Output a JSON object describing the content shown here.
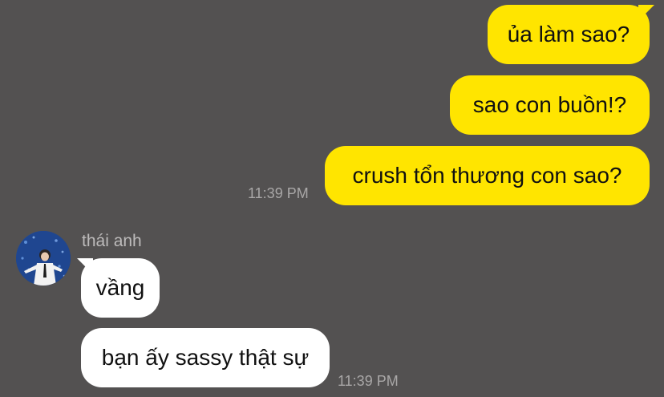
{
  "conversation": {
    "outgoing": [
      {
        "text": "ủa làm sao?"
      },
      {
        "text": "sao con buồn!?"
      },
      {
        "text": "crush tổn thương con sao?"
      }
    ],
    "outgoing_time": "11:39 PM",
    "incoming": {
      "sender_name": "thái anh",
      "avatar_icon": "profile-photo",
      "messages": [
        {
          "text": "vầng"
        },
        {
          "text": "bạn ấy sassy thật sự"
        }
      ],
      "time": "11:39 PM"
    }
  },
  "colors": {
    "background": "#535151",
    "outgoing_bubble": "#ffe500",
    "incoming_bubble": "#ffffff",
    "timestamp": "#a9a7a7"
  }
}
